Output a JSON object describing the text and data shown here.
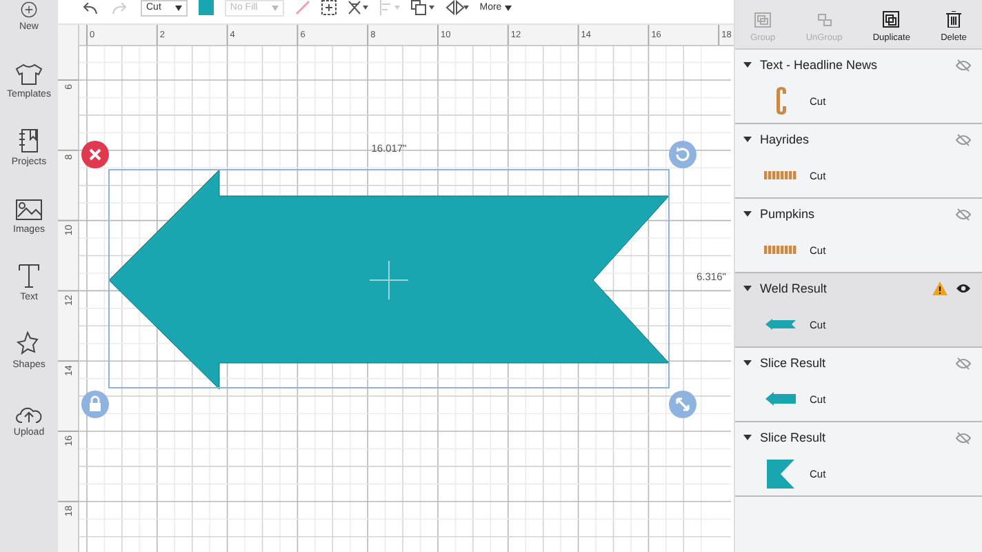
{
  "sidebar": [
    {
      "label": "New",
      "kind": "new"
    },
    {
      "label": "Templates",
      "kind": "shirt"
    },
    {
      "label": "Projects",
      "kind": "book"
    },
    {
      "label": "Images",
      "kind": "image"
    },
    {
      "label": "Text",
      "kind": "text"
    },
    {
      "label": "Shapes",
      "kind": "shapes"
    },
    {
      "label": "Upload",
      "kind": "upload"
    }
  ],
  "toolbar": {
    "operation": "Cut",
    "fill": "No Fill",
    "fill_disabled": true,
    "color": "#1aa6b1",
    "more": "More"
  },
  "ruler": {
    "x_labels": [
      "0",
      "2",
      "4",
      "6",
      "8",
      "10",
      "12",
      "14",
      "16",
      "18"
    ],
    "y_labels": [
      "6",
      "8",
      "10",
      "12",
      "14",
      "16",
      "18"
    ]
  },
  "canvas": {
    "width_label": "16.017\"",
    "height_label": "6.316\""
  },
  "actions": [
    {
      "label": "Group",
      "kind": "group",
      "disabled": true
    },
    {
      "label": "UnGroup",
      "kind": "ungroup",
      "disabled": true
    },
    {
      "label": "Duplicate",
      "kind": "duplicate",
      "disabled": false
    },
    {
      "label": "Delete",
      "kind": "delete",
      "disabled": false
    }
  ],
  "layers": [
    {
      "name": "Text - Headline News",
      "selected": false,
      "visible": false,
      "warning": false,
      "children": [
        {
          "kind": "letter",
          "operation": "Cut"
        }
      ]
    },
    {
      "name": "Hayrides",
      "selected": false,
      "visible": false,
      "warning": false,
      "children": [
        {
          "kind": "wordart",
          "operation": "Cut"
        }
      ]
    },
    {
      "name": "Pumpkins",
      "selected": false,
      "visible": false,
      "warning": false,
      "children": [
        {
          "kind": "wordart",
          "operation": "Cut"
        }
      ]
    },
    {
      "name": "Weld Result",
      "selected": true,
      "visible": true,
      "warning": true,
      "children": [
        {
          "kind": "notched-arrow",
          "operation": "Cut"
        }
      ]
    },
    {
      "name": "Slice Result",
      "selected": false,
      "visible": false,
      "warning": false,
      "children": [
        {
          "kind": "arrow",
          "operation": "Cut"
        }
      ]
    },
    {
      "name": "Slice Result",
      "selected": false,
      "visible": false,
      "warning": false,
      "children": [
        {
          "kind": "flag",
          "operation": "Cut"
        }
      ]
    }
  ]
}
